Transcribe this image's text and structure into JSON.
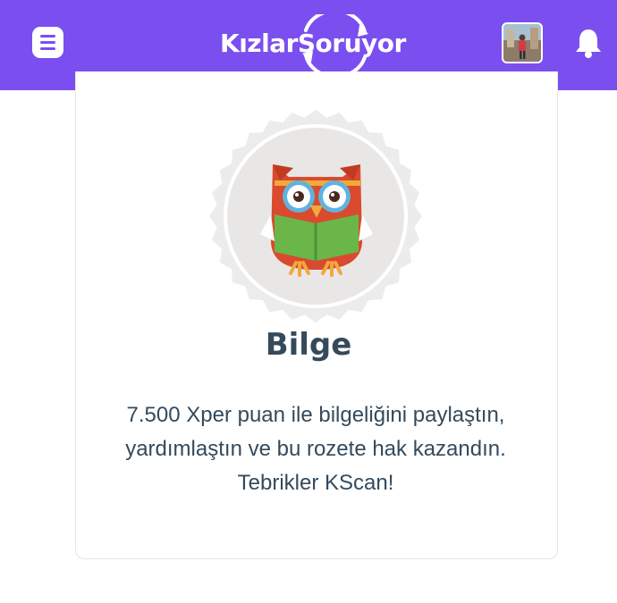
{
  "header": {
    "logo_text": "KızlarSoruyor",
    "menu_icon": "hamburger-menu-icon",
    "avatar_icon": "user-avatar",
    "notification_icon": "bell-icon"
  },
  "badge": {
    "icon": "owl-badge-icon",
    "title": "Bilge",
    "description_lines": [
      "7.500 Xper puan ile bilgeliğini paylaştın,",
      "yardımlaştın ve bu rozete hak kazandın.",
      "Tebrikler KScan!"
    ]
  },
  "colors": {
    "brand": "#7b4ef0",
    "text": "#344a5c",
    "badge_bg": "#e9e9e9"
  }
}
